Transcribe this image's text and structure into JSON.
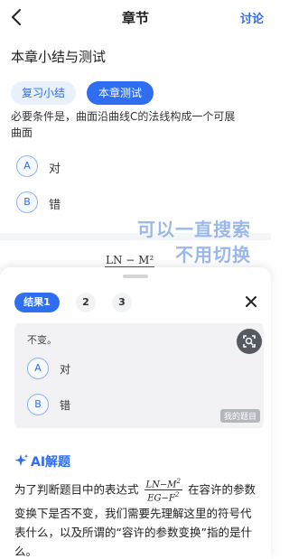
{
  "nav": {
    "title": "章节",
    "discuss_label": "讨论"
  },
  "section": {
    "title": "本章小结与测试"
  },
  "tabs": [
    {
      "label": "复习小结",
      "active": false
    },
    {
      "label": "本章测试",
      "active": true
    }
  ],
  "question": {
    "text_line1": "必要条件是，曲面沿曲线C的法线构成一个可展",
    "text_line2": "曲面",
    "options": [
      {
        "letter": "A",
        "label": "对"
      },
      {
        "letter": "B",
        "label": "错"
      }
    ],
    "formula_peek": "LN − M²"
  },
  "overlay": {
    "line1": "可以一直搜索",
    "line2": "不用切换"
  },
  "sheet": {
    "result_tabs": [
      "结果1",
      "2",
      "3"
    ],
    "card": {
      "text": "不变。",
      "options": [
        {
          "letter": "A",
          "label": "对"
        },
        {
          "letter": "B",
          "label": "错"
        }
      ],
      "tag": "我的题目"
    },
    "ai": {
      "label": "AI解题",
      "text_before": "为了判断题目中的表达式",
      "fraction_num": "LN−M",
      "fraction_den": "EG−F",
      "text_after": "在容许的参数变换下是否不变，我们需要先理解这里的符号代表什么，以及所谓的“容许的参数变换”指的是什么。"
    }
  },
  "colors": {
    "accent": "#2f6ef0",
    "tab_inactive_bg": "#e9f1fc",
    "card_bg": "#f2f2f4"
  }
}
